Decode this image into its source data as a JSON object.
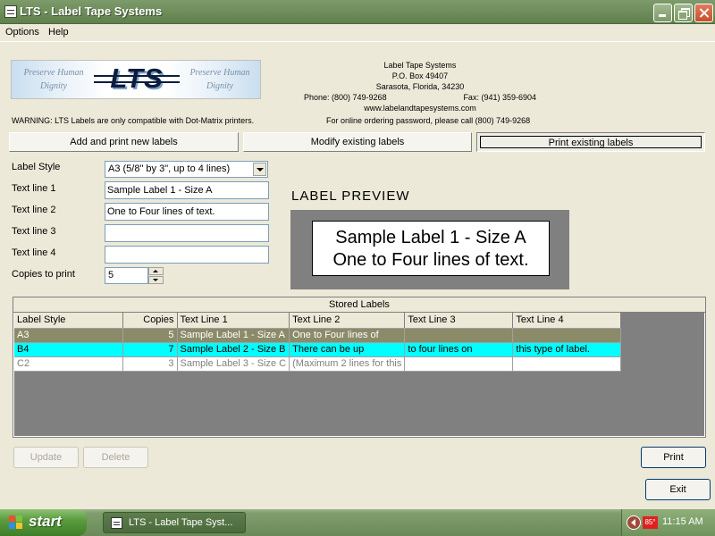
{
  "window": {
    "title": "LTS - Label Tape Systems"
  },
  "menu": {
    "items": [
      "Options",
      "Help"
    ]
  },
  "header": {
    "logo_text": "LTS",
    "logo_side_left": "Preserve Human Dignity",
    "logo_side_right": "Preserve Human Dignity",
    "company": {
      "name": "Label Tape Systems",
      "address1": "P.O. Box 49407",
      "address2": "Sarasota, Florida, 34230",
      "phone": "Phone: (800) 749-9268",
      "fax": "Fax: (941) 359-6904",
      "website": "www.labelandtapesystems.com"
    },
    "warning": "WARNING: LTS Labels are only compatible with Dot-Matrix printers.",
    "ordering_note": "For online ordering password, please call (800) 749-9268"
  },
  "tabs": [
    {
      "label": "Add and print new labels",
      "selected": false
    },
    {
      "label": "Modify existing labels",
      "selected": false
    },
    {
      "label": "Print existing labels",
      "selected": true
    }
  ],
  "form": {
    "label_style_label": "Label Style",
    "label_style_value": "A3 (5/8\" by 3\", up to 4 lines)",
    "text_line1_label": "Text line 1",
    "text_line1_value": "Sample Label 1 - Size A",
    "text_line2_label": "Text line 2",
    "text_line2_value": "One to Four lines of text.",
    "text_line3_label": "Text line 3",
    "text_line3_value": "",
    "text_line4_label": "Text line 4",
    "text_line4_value": "",
    "copies_label": "Copies to print",
    "copies_value": "5"
  },
  "preview": {
    "title": "LABEL PREVIEW",
    "line1": "Sample Label 1 - Size A",
    "line2": "One to Four lines of text."
  },
  "stored_labels": {
    "caption": "Stored Labels",
    "columns": [
      "Label Style",
      "Copies",
      "Text Line 1",
      "Text Line 2",
      "Text Line 3",
      "Text Line 4"
    ],
    "rows": [
      {
        "style": "A3",
        "copies": "5",
        "line1": "Sample Label 1 - Size A",
        "line2": "One to Four lines of",
        "line3": "",
        "line4": ""
      },
      {
        "style": "B4",
        "copies": "7",
        "line1": "Sample Label 2 - Size B",
        "line2": "There can be up",
        "line3": "to four lines on",
        "line4": "this type of label."
      },
      {
        "style": "C2",
        "copies": "3",
        "line1": "Sample Label 3 - Size C",
        "line2": "(Maximum 2 lines for this",
        "line3": "",
        "line4": ""
      }
    ]
  },
  "buttons": {
    "update": "Update",
    "delete": "Delete",
    "print": "Print",
    "exit": "Exit"
  },
  "taskbar": {
    "start": "start",
    "task_item": "LTS - Label Tape Syst...",
    "temperature": "85°",
    "clock": "11:15 AM"
  },
  "colors": {
    "titlebar": "#6f8f5c",
    "row_selected_a3": "#8b8b69",
    "row_highlight_b4": "#00ffff"
  }
}
